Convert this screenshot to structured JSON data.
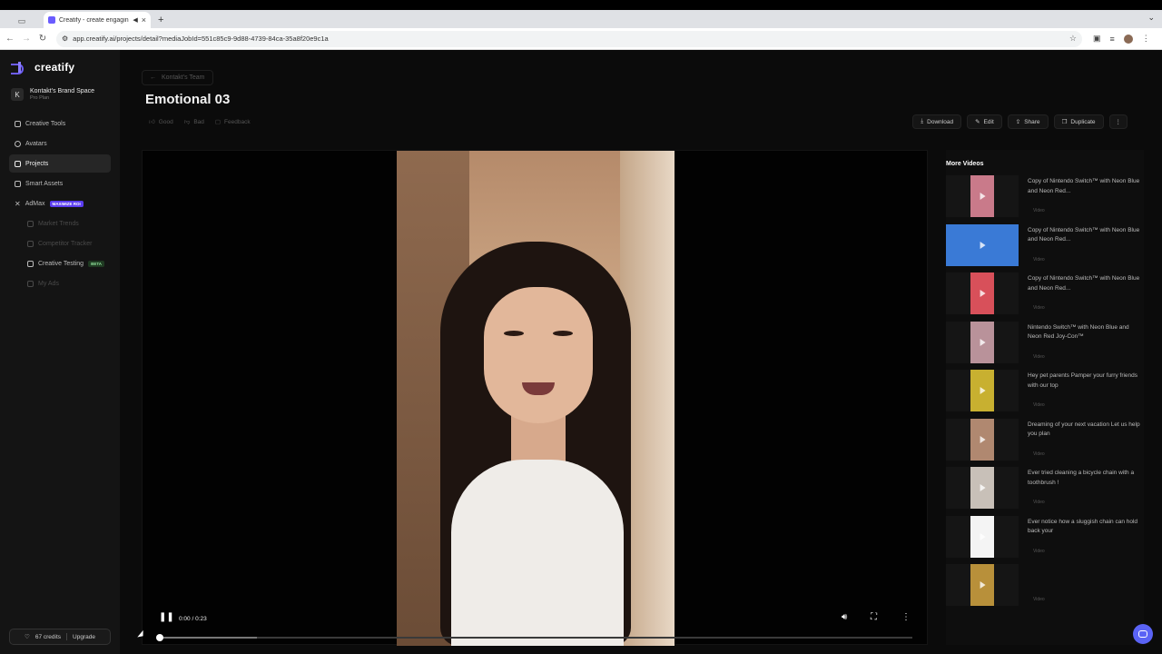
{
  "browser": {
    "tab_title": "Creatify - create engagin",
    "url": "app.creatify.ai/projects/detail?mediaJobId=551c85c9-9d88-4739-84ca-35a8f20e9c1a"
  },
  "sidebar": {
    "logo": "creatify",
    "brand_name": "Kontakt's Brand Space",
    "plan": "Pro Plan",
    "items": [
      {
        "label": "Creative Tools"
      },
      {
        "label": "Avatars"
      },
      {
        "label": "Projects"
      },
      {
        "label": "Smart Assets"
      },
      {
        "label": "AdMax",
        "badge": "MAXIMIZE ROI"
      },
      {
        "label": "Market Trends"
      },
      {
        "label": "Competitor Tracker"
      },
      {
        "label": "Creative Testing",
        "badge": "BETA"
      },
      {
        "label": "My Ads"
      }
    ],
    "credits": "67 credits",
    "upgrade": "Upgrade"
  },
  "main": {
    "back_label": "Kontakt's Team",
    "title": "Emotional 03",
    "feedback": {
      "good": "Good",
      "bad": "Bad",
      "feedback": "Feedback"
    },
    "actions": {
      "download": "Download",
      "edit": "Edit",
      "share": "Share",
      "duplicate": "Duplicate"
    },
    "player": {
      "time": "0:00 / 0:23",
      "progress": 0.0,
      "buffered": 0.13
    }
  },
  "more_videos": {
    "heading": "More Videos",
    "items": [
      {
        "title": "Copy of Nintendo Switch™ with Neon Blue and Neon Red...",
        "tag": "Video",
        "thumb_color": "#c97a8a"
      },
      {
        "title": "Copy of Nintendo Switch™ with Neon Blue and Neon Red...",
        "tag": "Video",
        "thumb_color": "#3a7ad6"
      },
      {
        "title": "Copy of Nintendo Switch™ with Neon Blue and Neon Red...",
        "tag": "Video",
        "thumb_color": "#d8505a"
      },
      {
        "title": "Nintendo Switch™ with Neon Blue and Neon Red Joy-Con™",
        "tag": "Video",
        "thumb_color": "#b9929a"
      },
      {
        "title": "Hey pet parents Pamper your furry friends with our top",
        "tag": "Video",
        "thumb_color": "#c8b030"
      },
      {
        "title": "Dreaming of your next vacation Let us help you plan",
        "tag": "Video",
        "thumb_color": "#b08870"
      },
      {
        "title": "Ever tried cleaning a bicycle chain with a toothbrush !",
        "tag": "Video",
        "thumb_color": "#c8c0b8"
      },
      {
        "title": "Ever notice how a sluggish chain can hold back your",
        "tag": "Video",
        "thumb_color": "#f4f4f4"
      },
      {
        "title": "",
        "tag": "Video",
        "thumb_color": "#b8903a"
      }
    ]
  }
}
